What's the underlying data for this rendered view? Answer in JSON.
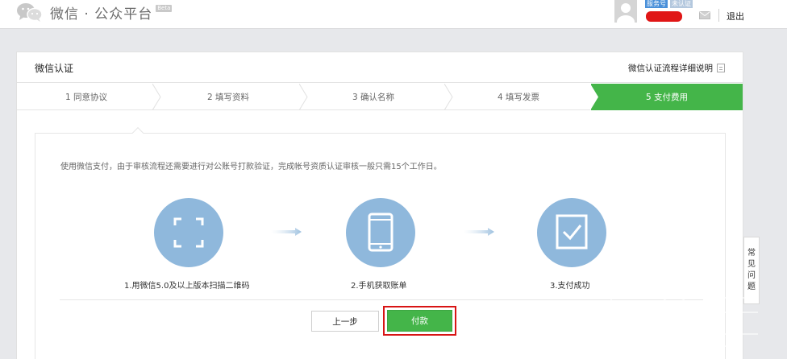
{
  "header": {
    "logo_text": "微信 · 公众平台",
    "beta_label": "Beta",
    "tags": [
      "服务号",
      "未认证"
    ],
    "logout_label": "退出"
  },
  "panel": {
    "title": "微信认证",
    "flow_link": "微信认证流程详细说明"
  },
  "steps": [
    {
      "label": "1 同意协议"
    },
    {
      "label": "2 填写资料"
    },
    {
      "label": "3 确认名称"
    },
    {
      "label": "4 填写发票"
    },
    {
      "label": "5 支付费用",
      "active": true
    }
  ],
  "content": {
    "info_text": "使用微信支付，由于审核流程还需要进行对公账号打款验证，完成帐号资质认证审核一般只需15个工作日。",
    "flow": [
      {
        "icon": "scan-frame-icon",
        "caption": "1.用微信5.0及以上版本扫描二维码"
      },
      {
        "icon": "phone-icon",
        "caption": "2.手机获取账单"
      },
      {
        "icon": "checkbox-icon",
        "caption": "3.支付成功"
      }
    ]
  },
  "buttons": {
    "prev_label": "上一步",
    "pay_label": "付款"
  },
  "faq": {
    "chars": [
      "常",
      "见",
      "问",
      "题"
    ]
  },
  "colors": {
    "accent_green": "#44b549",
    "icon_blue": "#8fb8dc",
    "highlight_red": "#d81414"
  }
}
